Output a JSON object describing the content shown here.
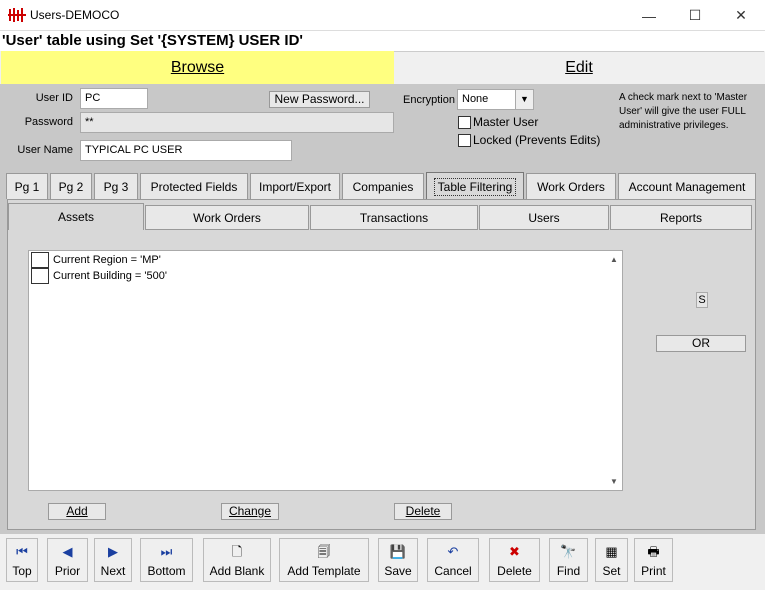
{
  "window": {
    "title": "Users-DEMOCO",
    "minimize": "—",
    "maximize": "☐",
    "close": "✕"
  },
  "table_title": "'User' table using Set '{SYSTEM} USER ID'",
  "modes": {
    "browse": "Browse",
    "edit": "Edit"
  },
  "form": {
    "user_id_label": "User ID",
    "user_id": "PC",
    "password_label": "Password",
    "password": "**",
    "user_name_label": "User Name",
    "user_name": "TYPICAL PC USER",
    "new_password": "New Password...",
    "encryption_label": "Encryption",
    "encryption": "None",
    "master_user": "Master User",
    "locked": "Locked (Prevents Edits)",
    "hint": "A check mark next to 'Master User' will give the user FULL administrative privileges."
  },
  "tabs": [
    "Pg 1",
    "Pg 2",
    "Pg 3",
    "Protected Fields",
    "Import/Export",
    "Companies",
    "Table Filtering",
    "Work Orders",
    "Account Management"
  ],
  "subtabs": [
    "Assets",
    "Work Orders",
    "Transactions",
    "Users",
    "Reports"
  ],
  "filters": [
    "Current Region = 'MP'",
    "Current Building = '500'"
  ],
  "side": {
    "s": "S",
    "or": "OR"
  },
  "list_buttons": {
    "add": "Add",
    "change": "Change",
    "delete": "Delete"
  },
  "toolbar": [
    "Top",
    "Prior",
    "Next",
    "Bottom",
    "Add Blank",
    "Add Template",
    "Save",
    "Cancel",
    "Delete",
    "Find",
    "Set",
    "Print"
  ],
  "colors": {
    "browse_bg": "#ffff80",
    "panel_bg": "#c8c8c8"
  }
}
